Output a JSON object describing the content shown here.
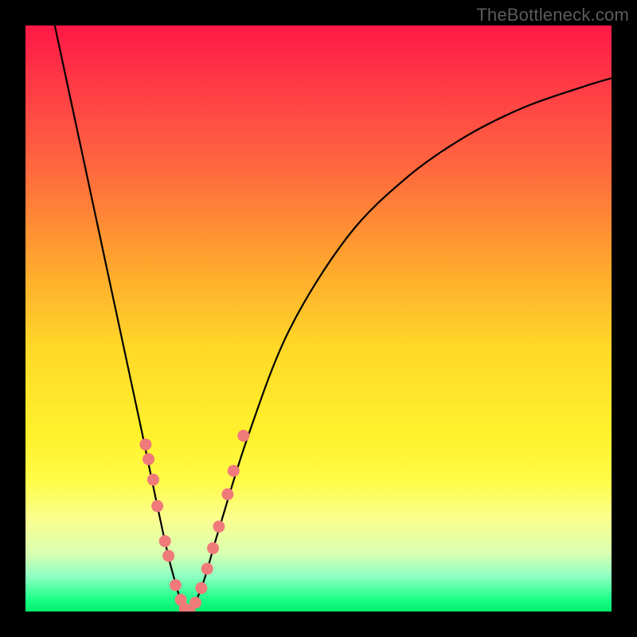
{
  "watermark": "TheBottleneck.com",
  "colors": {
    "frame": "#000000",
    "curve": "#000000",
    "marker_fill": "#f07a7a",
    "marker_stroke": "#e06868",
    "gradient_top": "#ff1846",
    "gradient_mid": "#fff22c",
    "gradient_bottom": "#00ec6a"
  },
  "chart_data": {
    "type": "line",
    "title": "",
    "xlabel": "",
    "ylabel": "",
    "xlim": [
      0,
      1
    ],
    "ylim": [
      0,
      1
    ],
    "series": [
      {
        "name": "bottleneck-curve",
        "x": [
          0.05,
          0.08,
          0.11,
          0.14,
          0.17,
          0.2,
          0.225,
          0.25,
          0.275,
          0.3,
          0.33,
          0.38,
          0.45,
          0.55,
          0.65,
          0.75,
          0.85,
          0.95,
          1.0
        ],
        "y": [
          1.0,
          0.86,
          0.72,
          0.58,
          0.44,
          0.3,
          0.18,
          0.07,
          0.0,
          0.04,
          0.14,
          0.3,
          0.48,
          0.64,
          0.74,
          0.81,
          0.86,
          0.895,
          0.91
        ]
      }
    ],
    "markers": {
      "name": "highlighted-points",
      "x": [
        0.205,
        0.21,
        0.218,
        0.225,
        0.238,
        0.244,
        0.256,
        0.265,
        0.272,
        0.28,
        0.29,
        0.3,
        0.31,
        0.32,
        0.33,
        0.345,
        0.355,
        0.372
      ],
      "y": [
        0.285,
        0.26,
        0.225,
        0.18,
        0.12,
        0.095,
        0.045,
        0.02,
        0.005,
        0.0,
        0.015,
        0.04,
        0.073,
        0.108,
        0.145,
        0.2,
        0.24,
        0.3
      ]
    }
  }
}
